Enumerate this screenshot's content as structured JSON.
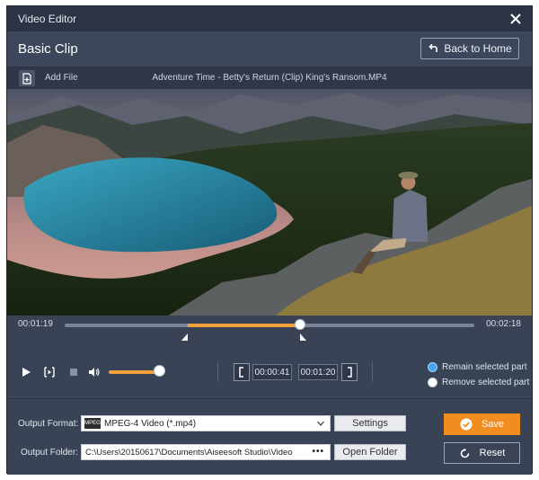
{
  "window": {
    "title": "Video Editor"
  },
  "header": {
    "section_title": "Basic Clip",
    "back_label": "Back to Home"
  },
  "filebar": {
    "add_label": "Add File",
    "file_name": "Adventure Time - Betty's Return (Clip) King's Ransom.MP4"
  },
  "timeline": {
    "current_time": "00:01:19",
    "total_time": "00:02:18",
    "selection_start_fraction": 0.3,
    "selection_end_fraction": 0.575
  },
  "controls": {
    "volume_fraction": 1.0,
    "start_time": "00:00:41",
    "end_time": "00:01:20",
    "options": [
      {
        "label": "Remain selected part",
        "selected": true
      },
      {
        "label": "Remove selected part",
        "selected": false
      }
    ]
  },
  "output": {
    "format_label": "Output Format:",
    "format_value": "MPEG-4 Video (*.mp4)",
    "format_icon": "MPEG",
    "settings_label": "Settings",
    "folder_label": "Output Folder:",
    "folder_value": "C:\\Users\\20150617\\Documents\\Aiseesoft Studio\\Video",
    "browse_label": "•••",
    "open_folder_label": "Open Folder",
    "save_label": "Save",
    "reset_label": "Reset"
  },
  "colors": {
    "accent": "#f18c21",
    "panel": "#394356",
    "titlebar": "#2b3344",
    "radio_on": "#4aa3f0"
  }
}
